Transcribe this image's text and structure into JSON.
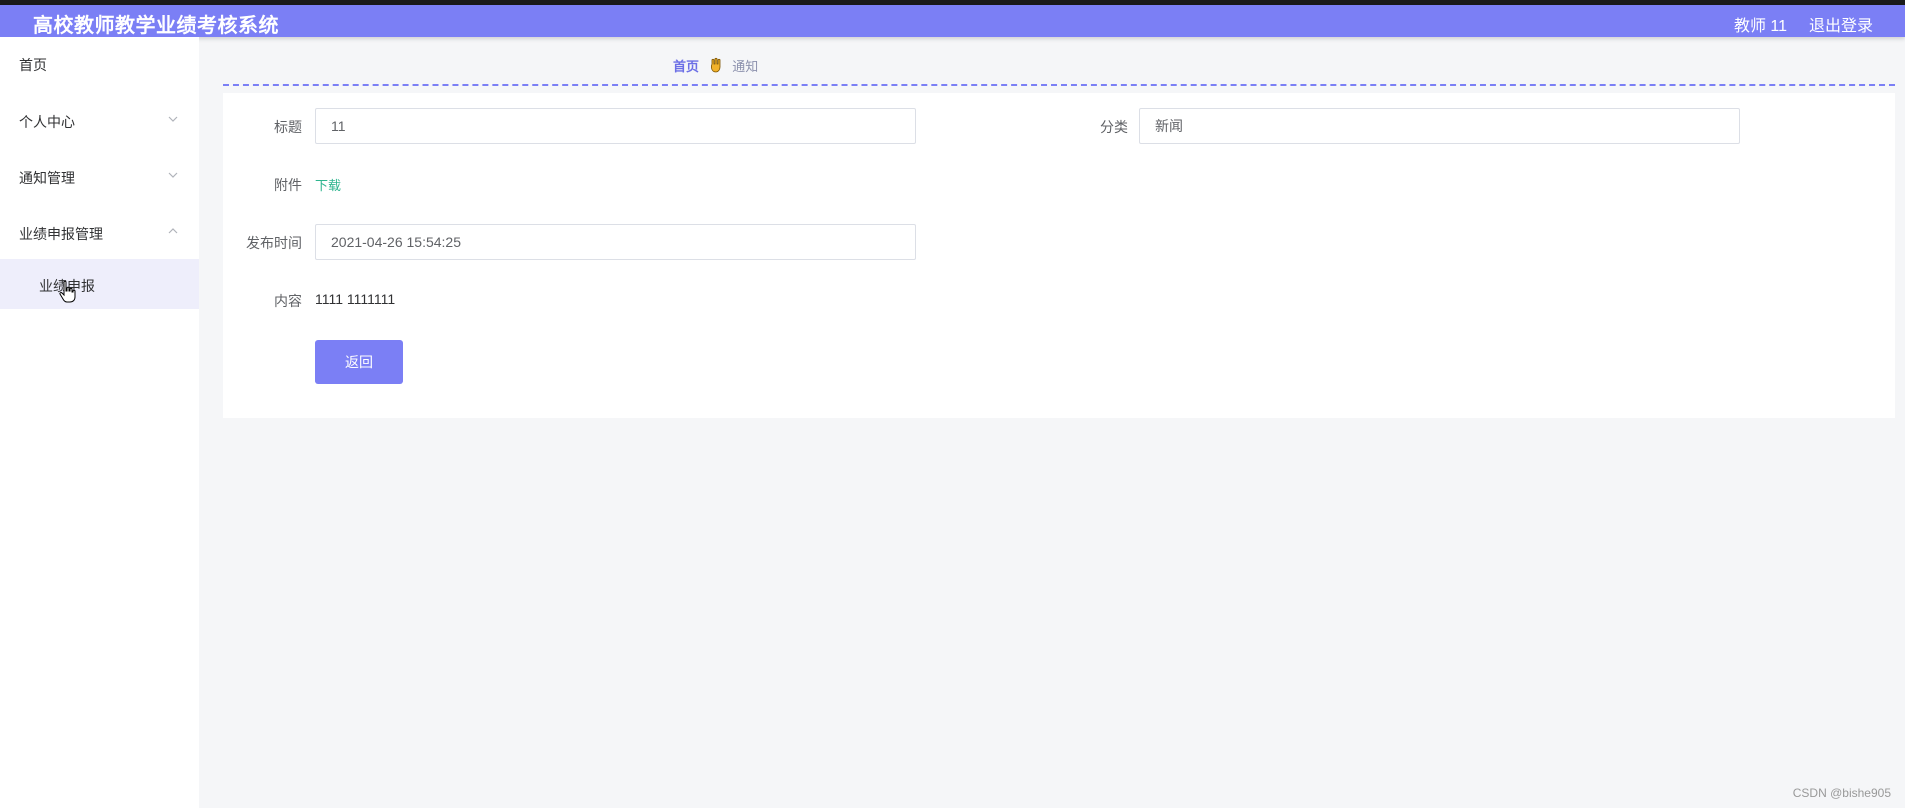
{
  "header": {
    "title": "高校教师教学业绩考核系统",
    "user": "教师 11",
    "logout": "退出登录"
  },
  "sidebar": {
    "items": [
      {
        "label": "首页"
      },
      {
        "label": "个人中心"
      },
      {
        "label": "通知管理"
      },
      {
        "label": "业绩申报管理"
      }
    ],
    "subitems": [
      {
        "label": "业绩申报"
      }
    ]
  },
  "breadcrumb": {
    "home": "首页",
    "current": "通知"
  },
  "form": {
    "title_label": "标题",
    "title_value": "11",
    "category_label": "分类",
    "category_value": "新闻",
    "attachment_label": "附件",
    "attachment_link": "下载",
    "publish_time_label": "发布时间",
    "publish_time_value": "2021-04-26 15:54:25",
    "content_label": "内容",
    "content_value": "1111 1111111",
    "back_button": "返回"
  },
  "watermark": "CSDN @bishe905",
  "colors": {
    "header": "#7b7ff5",
    "accent": "#6c6fe6",
    "link": "#2eb58f",
    "submenu_active_bg": "#eeeefb"
  }
}
